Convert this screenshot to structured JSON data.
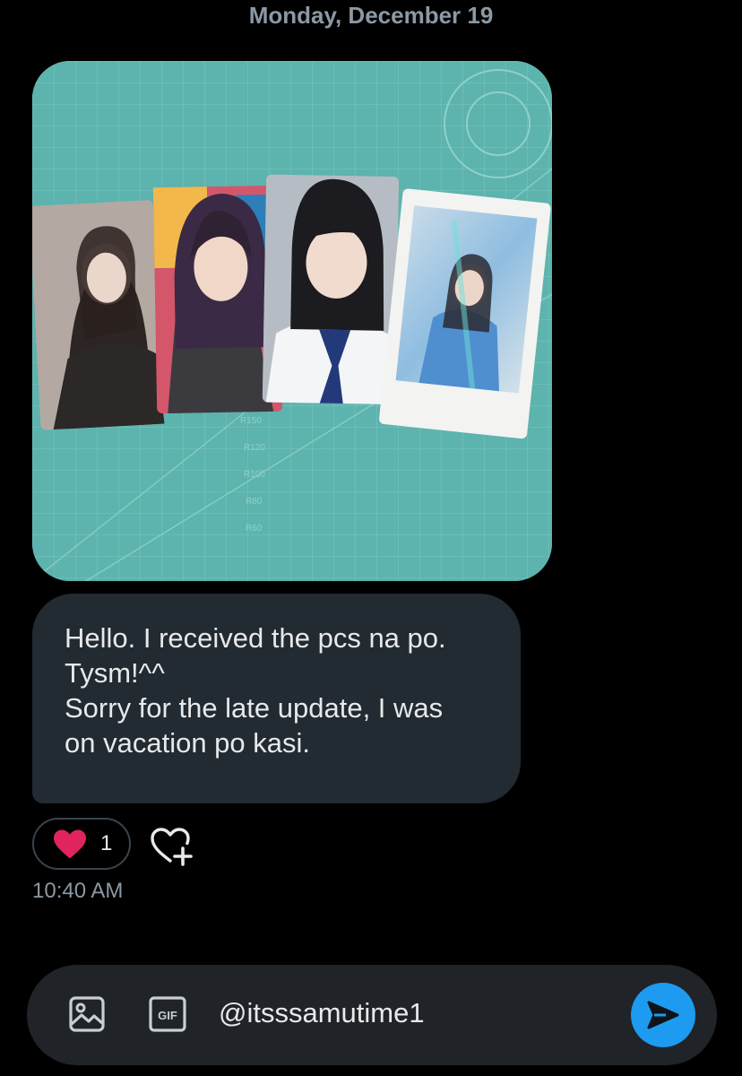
{
  "date_header": "Monday, December 19",
  "message": {
    "text": "Hello. I received the pcs na po.\nTysm!^^\nSorry for the late update, I was\non vacation po kasi.",
    "time": "10:40 AM",
    "reaction": {
      "icon": "heart-icon",
      "count": "1",
      "color": "#e0245e"
    }
  },
  "attachment": {
    "type": "photo",
    "mat_labels": [
      "R150",
      "R120",
      "R100",
      "R80",
      "R60"
    ]
  },
  "composer": {
    "value": "@itsssamutime1",
    "photo_icon": "image-icon",
    "gif_label": "GIF",
    "send_icon": "send-icon",
    "accent": "#1d9bf0"
  }
}
